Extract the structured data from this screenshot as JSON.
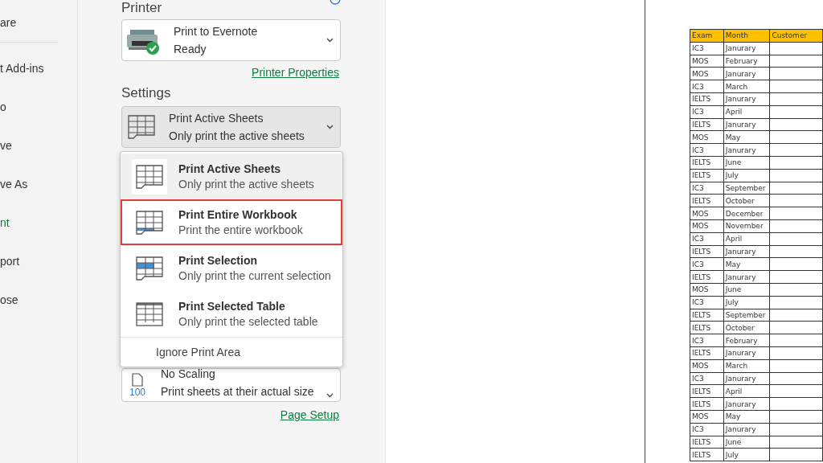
{
  "nav": {
    "items": [
      {
        "label": "are",
        "selected": false,
        "divider_after": true
      },
      {
        "label": "t Add-ins",
        "selected": false,
        "divider_after": false
      },
      {
        "label": "o",
        "selected": false,
        "divider_after": false
      },
      {
        "label": "ve",
        "selected": false,
        "divider_after": false
      },
      {
        "label": "ve As",
        "selected": false,
        "divider_after": false
      },
      {
        "label": "nt",
        "selected": true,
        "divider_after": false
      },
      {
        "label": "port",
        "selected": false,
        "divider_after": false
      },
      {
        "label": "ose",
        "selected": false,
        "divider_after": false
      }
    ]
  },
  "printer": {
    "heading": "Printer",
    "name": "Print to Evernote",
    "status": "Ready",
    "properties_link": "Printer Properties"
  },
  "settings": {
    "heading": "Settings",
    "current": {
      "title": "Print Active Sheets",
      "subtitle": "Only print the active sheets"
    },
    "menu": {
      "items": [
        {
          "kind": "active",
          "title": "Print Active Sheets",
          "subtitle": "Only print the active sheets",
          "selected": true,
          "highlighted": false
        },
        {
          "kind": "workbook",
          "title": "Print Entire Workbook",
          "subtitle": "Print the entire workbook",
          "selected": false,
          "highlighted": true
        },
        {
          "kind": "selection",
          "title": "Print Selection",
          "subtitle": "Only print the current selection",
          "selected": false,
          "highlighted": false
        },
        {
          "kind": "table",
          "title": "Print Selected Table",
          "subtitle": "Only print the selected table",
          "selected": false,
          "highlighted": false
        }
      ],
      "footer": "Ignore Print Area"
    },
    "scaling": {
      "title": "No Scaling",
      "subtitle": "Print sheets at their actual size",
      "icon_text": "100"
    },
    "page_setup_link": "Page Setup"
  },
  "preview": {
    "table": {
      "columns": [
        "Exam",
        "Month",
        "Customer"
      ],
      "rows": [
        [
          "IC3",
          "Janurary"
        ],
        [
          "MOS",
          "February"
        ],
        [
          "MOS",
          "Janurary"
        ],
        [
          "IC3",
          "March"
        ],
        [
          "IELTS",
          "Janurary"
        ],
        [
          "IC3",
          "April"
        ],
        [
          "IELTS",
          "Janurary"
        ],
        [
          "MOS",
          "May"
        ],
        [
          "IC3",
          "Janurary"
        ],
        [
          "IELTS",
          "June"
        ],
        [
          "IELTS",
          "July"
        ],
        [
          "IC3",
          "September"
        ],
        [
          "IELTS",
          "October"
        ],
        [
          "MOS",
          "December"
        ],
        [
          "MOS",
          "November"
        ],
        [
          "IC3",
          "April"
        ],
        [
          "IELTS",
          "Janurary"
        ],
        [
          "IC3",
          "May"
        ],
        [
          "IELTS",
          "Janurary"
        ],
        [
          "MOS",
          "June"
        ],
        [
          "IC3",
          "July"
        ],
        [
          "IELTS",
          "September"
        ],
        [
          "IELTS",
          "October"
        ],
        [
          "IC3",
          "February"
        ],
        [
          "IELTS",
          "Janurary"
        ],
        [
          "MOS",
          "March"
        ],
        [
          "IC3",
          "Janurary"
        ],
        [
          "IELTS",
          "April"
        ],
        [
          "IELTS",
          "Janurary"
        ],
        [
          "MOS",
          "May"
        ],
        [
          "IC3",
          "Janurary"
        ],
        [
          "IELTS",
          "June"
        ],
        [
          "IELTS",
          "July"
        ]
      ]
    }
  }
}
